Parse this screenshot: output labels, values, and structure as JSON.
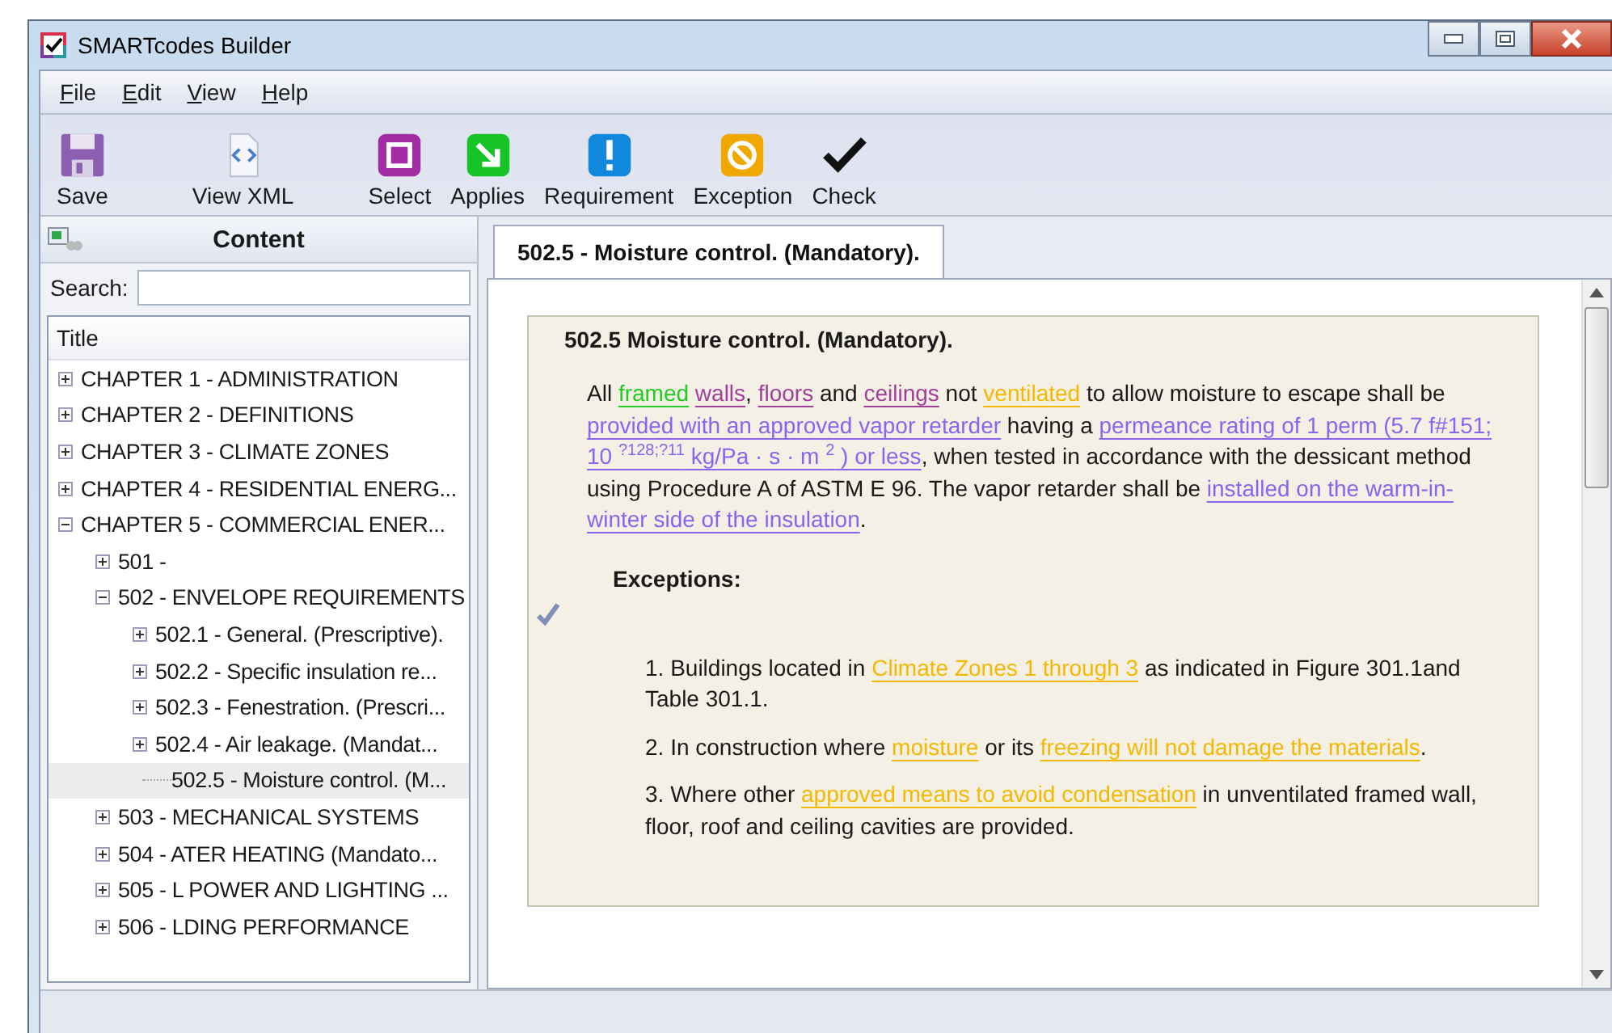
{
  "window": {
    "title": "SMARTcodes Builder"
  },
  "menu": [
    "File",
    "Edit",
    "View",
    "Help"
  ],
  "toolbar": [
    {
      "kind": "save",
      "label": "Save"
    },
    {
      "kind": "xml",
      "label": "View XML"
    },
    {
      "kind": "select",
      "label": "Select"
    },
    {
      "kind": "applies",
      "label": "Applies"
    },
    {
      "kind": "requirement",
      "label": "Requirement"
    },
    {
      "kind": "exception",
      "label": "Exception"
    },
    {
      "kind": "check",
      "label": "Check"
    }
  ],
  "sidebar": {
    "title": "Content",
    "search": {
      "label": "Search:"
    },
    "column": "Title",
    "tree": [
      {
        "label": "CHAPTER 1 - ADMINISTRATION",
        "expanded": false,
        "selected": false
      },
      {
        "label": "CHAPTER 2 - DEFINITIONS",
        "expanded": false,
        "selected": false
      },
      {
        "label": "CHAPTER 3 - CLIMATE ZONES",
        "expanded": false,
        "selected": false
      },
      {
        "label": "CHAPTER 4 - RESIDENTIAL ENERG...",
        "expanded": false,
        "selected": false
      },
      {
        "label": "CHAPTER 5 - COMMERCIAL ENER...",
        "expanded": true,
        "selected": false,
        "children": [
          {
            "label": "501 -",
            "expanded": false,
            "selected": false
          },
          {
            "label": "502 - ENVELOPE REQUIREMENTS",
            "expanded": true,
            "selected": false,
            "children": [
              {
                "label": "502.1 - General. (Prescriptive).",
                "expanded": false,
                "selected": false
              },
              {
                "label": "502.2 - Specific insulation re...",
                "expanded": false,
                "selected": false
              },
              {
                "label": "502.3 - Fenestration. (Prescri...",
                "expanded": false,
                "selected": false
              },
              {
                "label": "502.4 - Air leakage. (Mandat...",
                "expanded": false,
                "selected": false
              },
              {
                "label": "502.5 - Moisture control. (M...",
                "leaf": true,
                "selected": true
              }
            ]
          },
          {
            "label": "503 - MECHANICAL SYSTEMS",
            "expanded": false,
            "selected": false
          },
          {
            "label": "504 - ATER HEATING (Mandato...",
            "expanded": false,
            "selected": false
          },
          {
            "label": "505 - L POWER AND LIGHTING ...",
            "expanded": false,
            "selected": false
          },
          {
            "label": "506 - LDING PERFORMANCE",
            "expanded": false,
            "selected": false
          }
        ]
      }
    ]
  },
  "tabs": [
    {
      "label": "502.5 - Moisture control. (Mandatory).",
      "selected": true
    }
  ],
  "document": {
    "heading": "502.5 Moisture control. (Mandatory).",
    "paragraph": [
      {
        "text": "All "
      },
      {
        "text": "framed",
        "color": "#22cc22"
      },
      {
        "text": " walls",
        "color": "#a0409a"
      },
      {
        "text": ", "
      },
      {
        "text": "floors",
        "color": "#a0409a"
      },
      {
        "text": " and "
      },
      {
        "text": "ceilings",
        "color": "#a0409a"
      },
      {
        "text": " not "
      },
      {
        "text": "ventilated",
        "color": "#f5b800"
      },
      {
        "text": " to allow moisture to escape shall be "
      },
      {
        "text": "provided with an approved vapor retarder",
        "color": "#8a63f0"
      },
      {
        "text": " having a "
      },
      {
        "text": "permeance rating of 1 perm (5.7 f#151; 10 $^{?128;?11}$ kg/Pa · s · m $^{2}$ ) or less",
        "color": "#8a63f0"
      },
      {
        "text": ", when tested in accordance with the dessicant method using Procedure A of ASTM E 96. The vapor retarder shall be "
      },
      {
        "text": "installed on the warm-in-winter side of the insulation",
        "color": "#8a63f0"
      },
      {
        "text": "."
      }
    ],
    "exceptions_title": "Exceptions:",
    "exceptions": [
      [
        {
          "text": "1. Buildings located in "
        },
        {
          "text": "Climate Zones 1 through 3",
          "color": "#f5b800"
        },
        {
          "text": " as indicated in Figure 301.1and Table 301.1."
        }
      ],
      [
        {
          "text": "2. In construction where "
        },
        {
          "text": "moisture",
          "color": "#f5b800"
        },
        {
          "text": " or its "
        },
        {
          "text": "freezing will not damage the materials",
          "color": "#f5b800"
        },
        {
          "text": "."
        }
      ],
      [
        {
          "text": "3. Where other "
        },
        {
          "text": "approved means to avoid condensation",
          "color": "#f5b800"
        },
        {
          "text": " in unventilated framed wall, floor, roof and ceiling cavities are provided."
        }
      ]
    ]
  }
}
